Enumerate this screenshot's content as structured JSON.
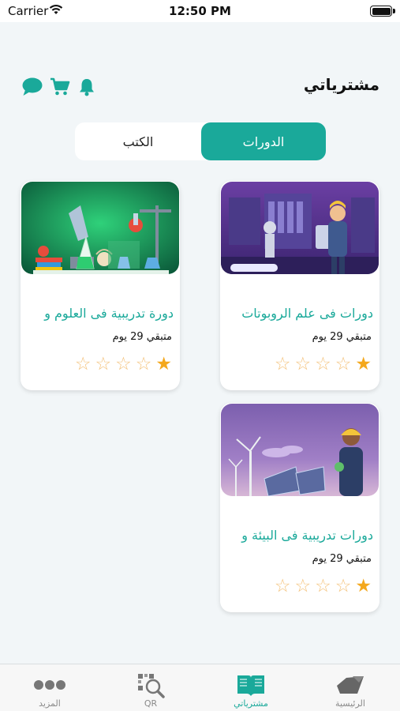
{
  "status_bar": {
    "carrier": "Carrier",
    "time": "12:50 PM"
  },
  "header": {
    "title": "مشترياتي",
    "icons": [
      "chat-icon",
      "cart-icon",
      "bell-icon"
    ]
  },
  "segment": {
    "active_label": "الدورات",
    "inactive_label": "الكتب"
  },
  "colors": {
    "accent": "#1aa99a",
    "star": "#f4a81d"
  },
  "courses": [
    {
      "title": "دورات فى علم الروبوتات",
      "remaining": "متبقي 29 يوم",
      "rating": 1,
      "max_rating": 5,
      "image": "robotics-illustration"
    },
    {
      "title": "دورة تدريبية فى العلوم و",
      "remaining": "متبقي 29 يوم",
      "rating": 1,
      "max_rating": 5,
      "image": "science-lab-illustration"
    },
    {
      "title": "دورات تدريبية فى البيئة و",
      "remaining": "متبقي 29 يوم",
      "rating": 1,
      "max_rating": 5,
      "image": "renewable-energy-illustration"
    }
  ],
  "tabbar": {
    "items": [
      {
        "label": "الرئيسية",
        "icon": "home-icon"
      },
      {
        "label": "مشترياتي",
        "icon": "book-icon",
        "active": true
      },
      {
        "label": "QR",
        "icon": "qr-scan-icon"
      },
      {
        "label": "المزيد",
        "icon": "more-icon"
      }
    ]
  }
}
